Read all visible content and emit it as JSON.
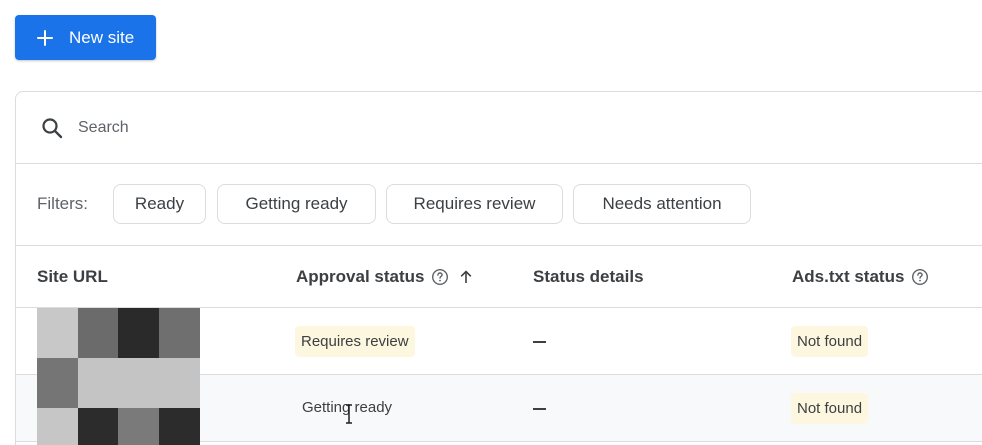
{
  "toolbar": {
    "new_site_label": "New site"
  },
  "search": {
    "placeholder": "Search"
  },
  "filters": {
    "label": "Filters:",
    "chips": [
      "Ready",
      "Getting ready",
      "Requires review",
      "Needs attention"
    ]
  },
  "table": {
    "columns": [
      "Site URL",
      "Approval status",
      "Status details",
      "Ads.txt status"
    ],
    "sorted_column": "Approval status",
    "sort_direction": "ascending",
    "rows": [
      {
        "approval_status": "Requires review",
        "status_details": "—",
        "ads_txt_status": "Not found"
      },
      {
        "approval_status": "Getting ready",
        "status_details": "—",
        "ads_txt_status": "Not found"
      }
    ]
  },
  "colors": {
    "accent": "#1a73e8",
    "badge_bg": "#fef7e0",
    "border": "#dadce0",
    "text": "#3c4043"
  }
}
